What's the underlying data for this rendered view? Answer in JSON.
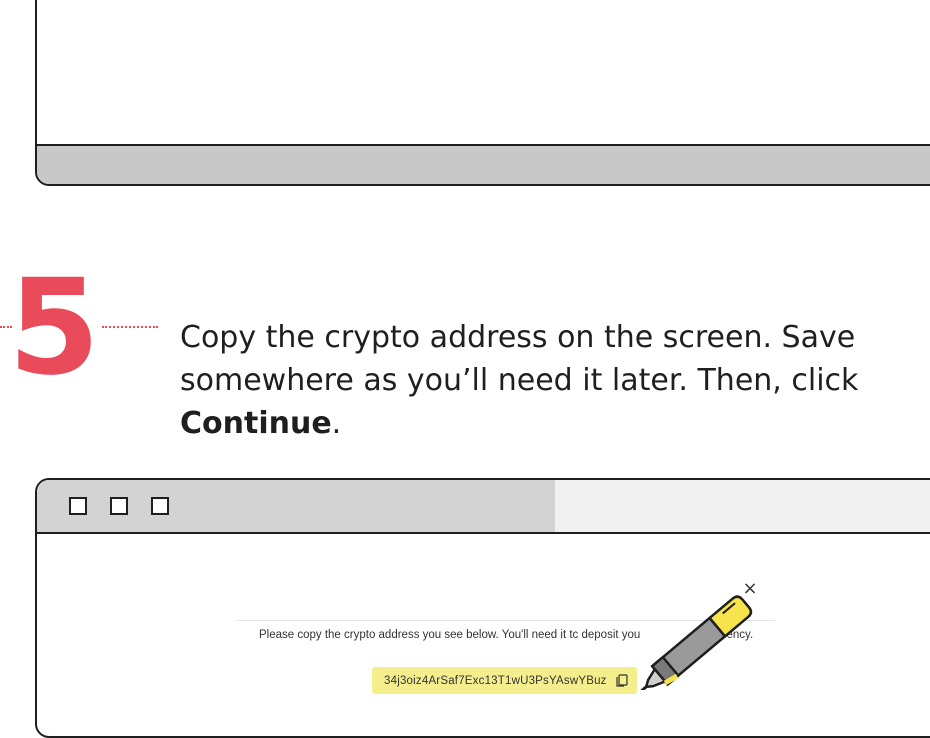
{
  "step": {
    "number": "5",
    "text_line1": "Copy the crypto address on the screen. Save",
    "text_line2": "somewhere as you’ll need it later. Then, click",
    "text_bold": "Continue",
    "text_end": "."
  },
  "dialog": {
    "close_symbol": "×",
    "instructions": "Please copy the crypto address you see below. You'll need it tc deposit you",
    "instructions_end": "ocurrency.",
    "address": "34j3oiz4ArSaf7Exc13T1wU3PsYAswYBuz"
  },
  "colors": {
    "accent": "#ea4b5a",
    "highlight": "#f5ee8c",
    "marker_yellow": "#f7e34b",
    "frame_gray": "#c8c8c8"
  },
  "icons": {
    "close": "close-icon",
    "copy": "copy-icon",
    "marker": "highlighter-marker-icon"
  }
}
